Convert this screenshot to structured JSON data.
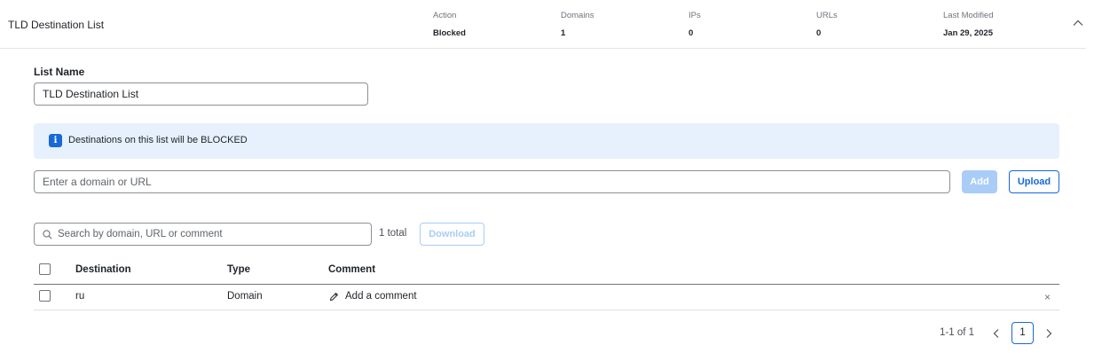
{
  "header": {
    "title": "TLD Destination List",
    "stats": [
      {
        "label": "Action",
        "value": "Blocked"
      },
      {
        "label": "Domains",
        "value": "1"
      },
      {
        "label": "IPs",
        "value": "0"
      },
      {
        "label": "URLs",
        "value": "0"
      },
      {
        "label": "Last Modified",
        "value": "Jan 29, 2025"
      }
    ],
    "collapse_icon": "chevron-up-icon"
  },
  "form": {
    "list_name_label": "List Name",
    "list_name_value": "TLD Destination List"
  },
  "banner": {
    "icon": "info-icon",
    "message": "Destinations on this list will be BLOCKED"
  },
  "add_destination": {
    "placeholder": "Enter a domain or URL",
    "add_label": "Add",
    "upload_label": "Upload"
  },
  "search": {
    "placeholder": "Search by domain, URL or comment",
    "total": "1 total",
    "download_label": "Download"
  },
  "table": {
    "columns": [
      "Destination",
      "Type",
      "Comment"
    ],
    "rows": [
      {
        "destination": "ru",
        "type": "Domain",
        "comment": "Add a comment"
      }
    ]
  },
  "pagination": {
    "range": "1-1 of 1",
    "current_page": "1"
  },
  "colors": {
    "accent": "#1868d8",
    "banner_bg": "#e6f1fd",
    "disabled_accent": "#a9cdf6"
  }
}
